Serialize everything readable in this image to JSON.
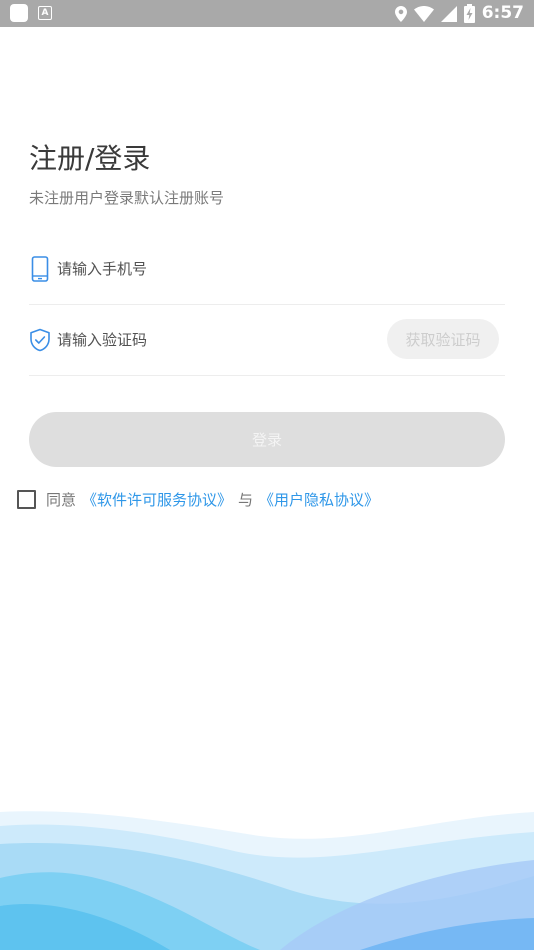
{
  "status_bar": {
    "time": "6:57",
    "icons": [
      "app-icon",
      "accessibility-a-icon",
      "location-icon",
      "wifi-icon",
      "cell-signal-icon",
      "battery-charging-icon"
    ]
  },
  "header": {
    "title": "注册/登录",
    "subtitle": "未注册用户登录默认注册账号"
  },
  "form": {
    "phone_placeholder": "请输入手机号",
    "code_placeholder": "请输入验证码",
    "get_code_label": "获取验证码",
    "login_label": "登录"
  },
  "agreement": {
    "prefix": "同意",
    "software_license_link": "《软件许可服务协议》",
    "connector": "与",
    "privacy_link": "《用户隐私协议》",
    "checked": false
  },
  "colors": {
    "link": "#2f97e8",
    "icon_blue": "#3a8ee6",
    "button_disabled": "#dedede",
    "status_bar": "#a9a9a9"
  }
}
